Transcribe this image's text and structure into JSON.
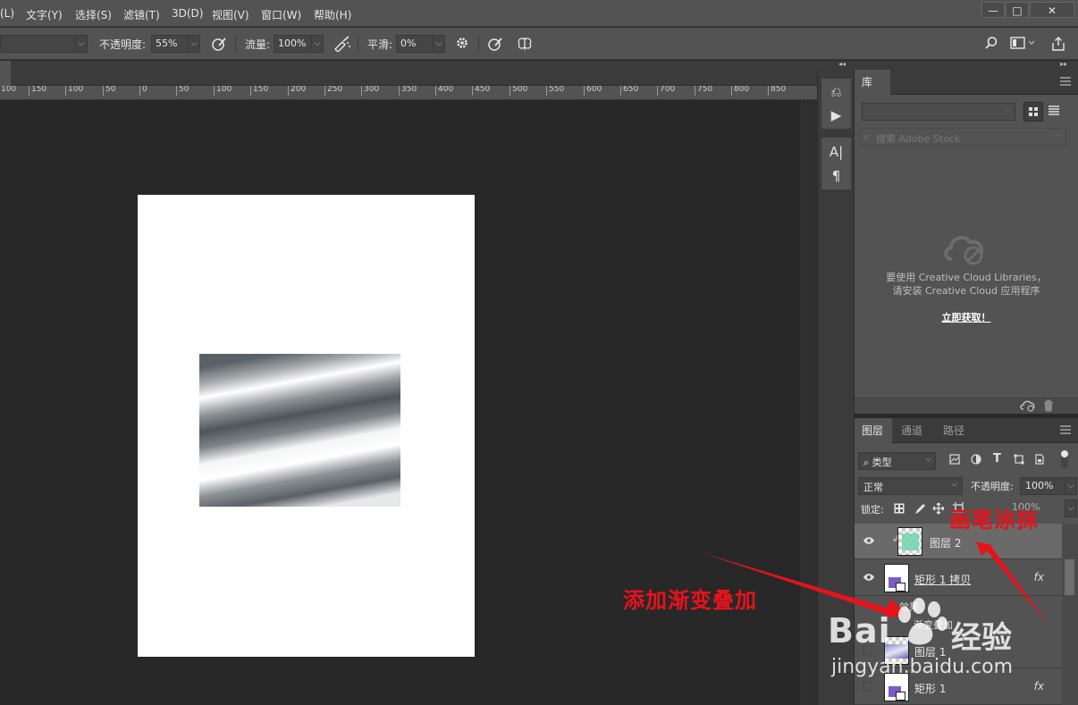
{
  "menubar": {
    "items": [
      "(L)",
      "文字(Y)",
      "选择(S)",
      "滤镜(T)",
      "3D(D)",
      "视图(V)",
      "窗口(W)",
      "帮助(H)"
    ],
    "window_controls": {
      "minimize": "—",
      "maximize": "□",
      "close": "✕"
    }
  },
  "options": {
    "opacity_label": "不透明度:",
    "opacity_value": "55%",
    "flow_label": "流量:",
    "flow_value": "100%",
    "smooth_label": "平滑:",
    "smooth_value": "0%",
    "dropdown_arrow": "⌵"
  },
  "ruler": {
    "ticks": [
      "100",
      "150",
      "100",
      "50",
      "0",
      "50",
      "100",
      "150",
      "200",
      "250",
      "300",
      "350",
      "400",
      "450",
      "500",
      "550",
      "600",
      "650",
      "700",
      "750",
      "800",
      "850"
    ]
  },
  "toolcol": {
    "collapse_glyph": "◂◂",
    "tools": [
      "history-icon",
      "play-icon",
      "character-icon",
      "paragraph-icon"
    ],
    "tool_glyphs": [
      "⎌",
      "▶",
      "A|",
      "¶"
    ]
  },
  "library": {
    "collapse_glyph": "▸▸",
    "tab": "库",
    "search_placeholder": "搜索 Adobe Stock",
    "message_line1": "要使用 Creative Cloud Libraries，",
    "message_line2": "请安装 Creative Cloud 应用程序",
    "link": "立即获取！"
  },
  "layers": {
    "tabs": [
      "图层",
      "通道",
      "路径"
    ],
    "filter_type": "类型",
    "blend_mode": "正常",
    "opacity_label": "不透明度:",
    "opacity_value": "100%",
    "lock_label": "锁定:",
    "fill_value": "100%",
    "rows": [
      {
        "name": "图层 2",
        "selected": true,
        "has_fx": false
      },
      {
        "name": "矩形 1 拷贝",
        "selected": false,
        "has_fx": true
      },
      {
        "name": "图层 1",
        "selected": false,
        "has_fx": false
      },
      {
        "name": "矩形 1",
        "selected": false,
        "has_fx": true
      }
    ],
    "effects_label": "效果",
    "gradient_overlay_label": "渐变叠加",
    "fx_glyph": "fx"
  },
  "annotations": {
    "brush_note": "画笔涂抹",
    "gradient_note": "添加渐变叠加",
    "color": "#e8121b"
  },
  "watermark": {
    "logo_left": "Bai",
    "logo_right": "经验",
    "url": "jingyan.baidu.com"
  },
  "colors": {
    "panel_bg": "#535353",
    "canvas_bg": "#282828",
    "document_bg": "#ffffff",
    "annotation_red": "#e8121b"
  }
}
